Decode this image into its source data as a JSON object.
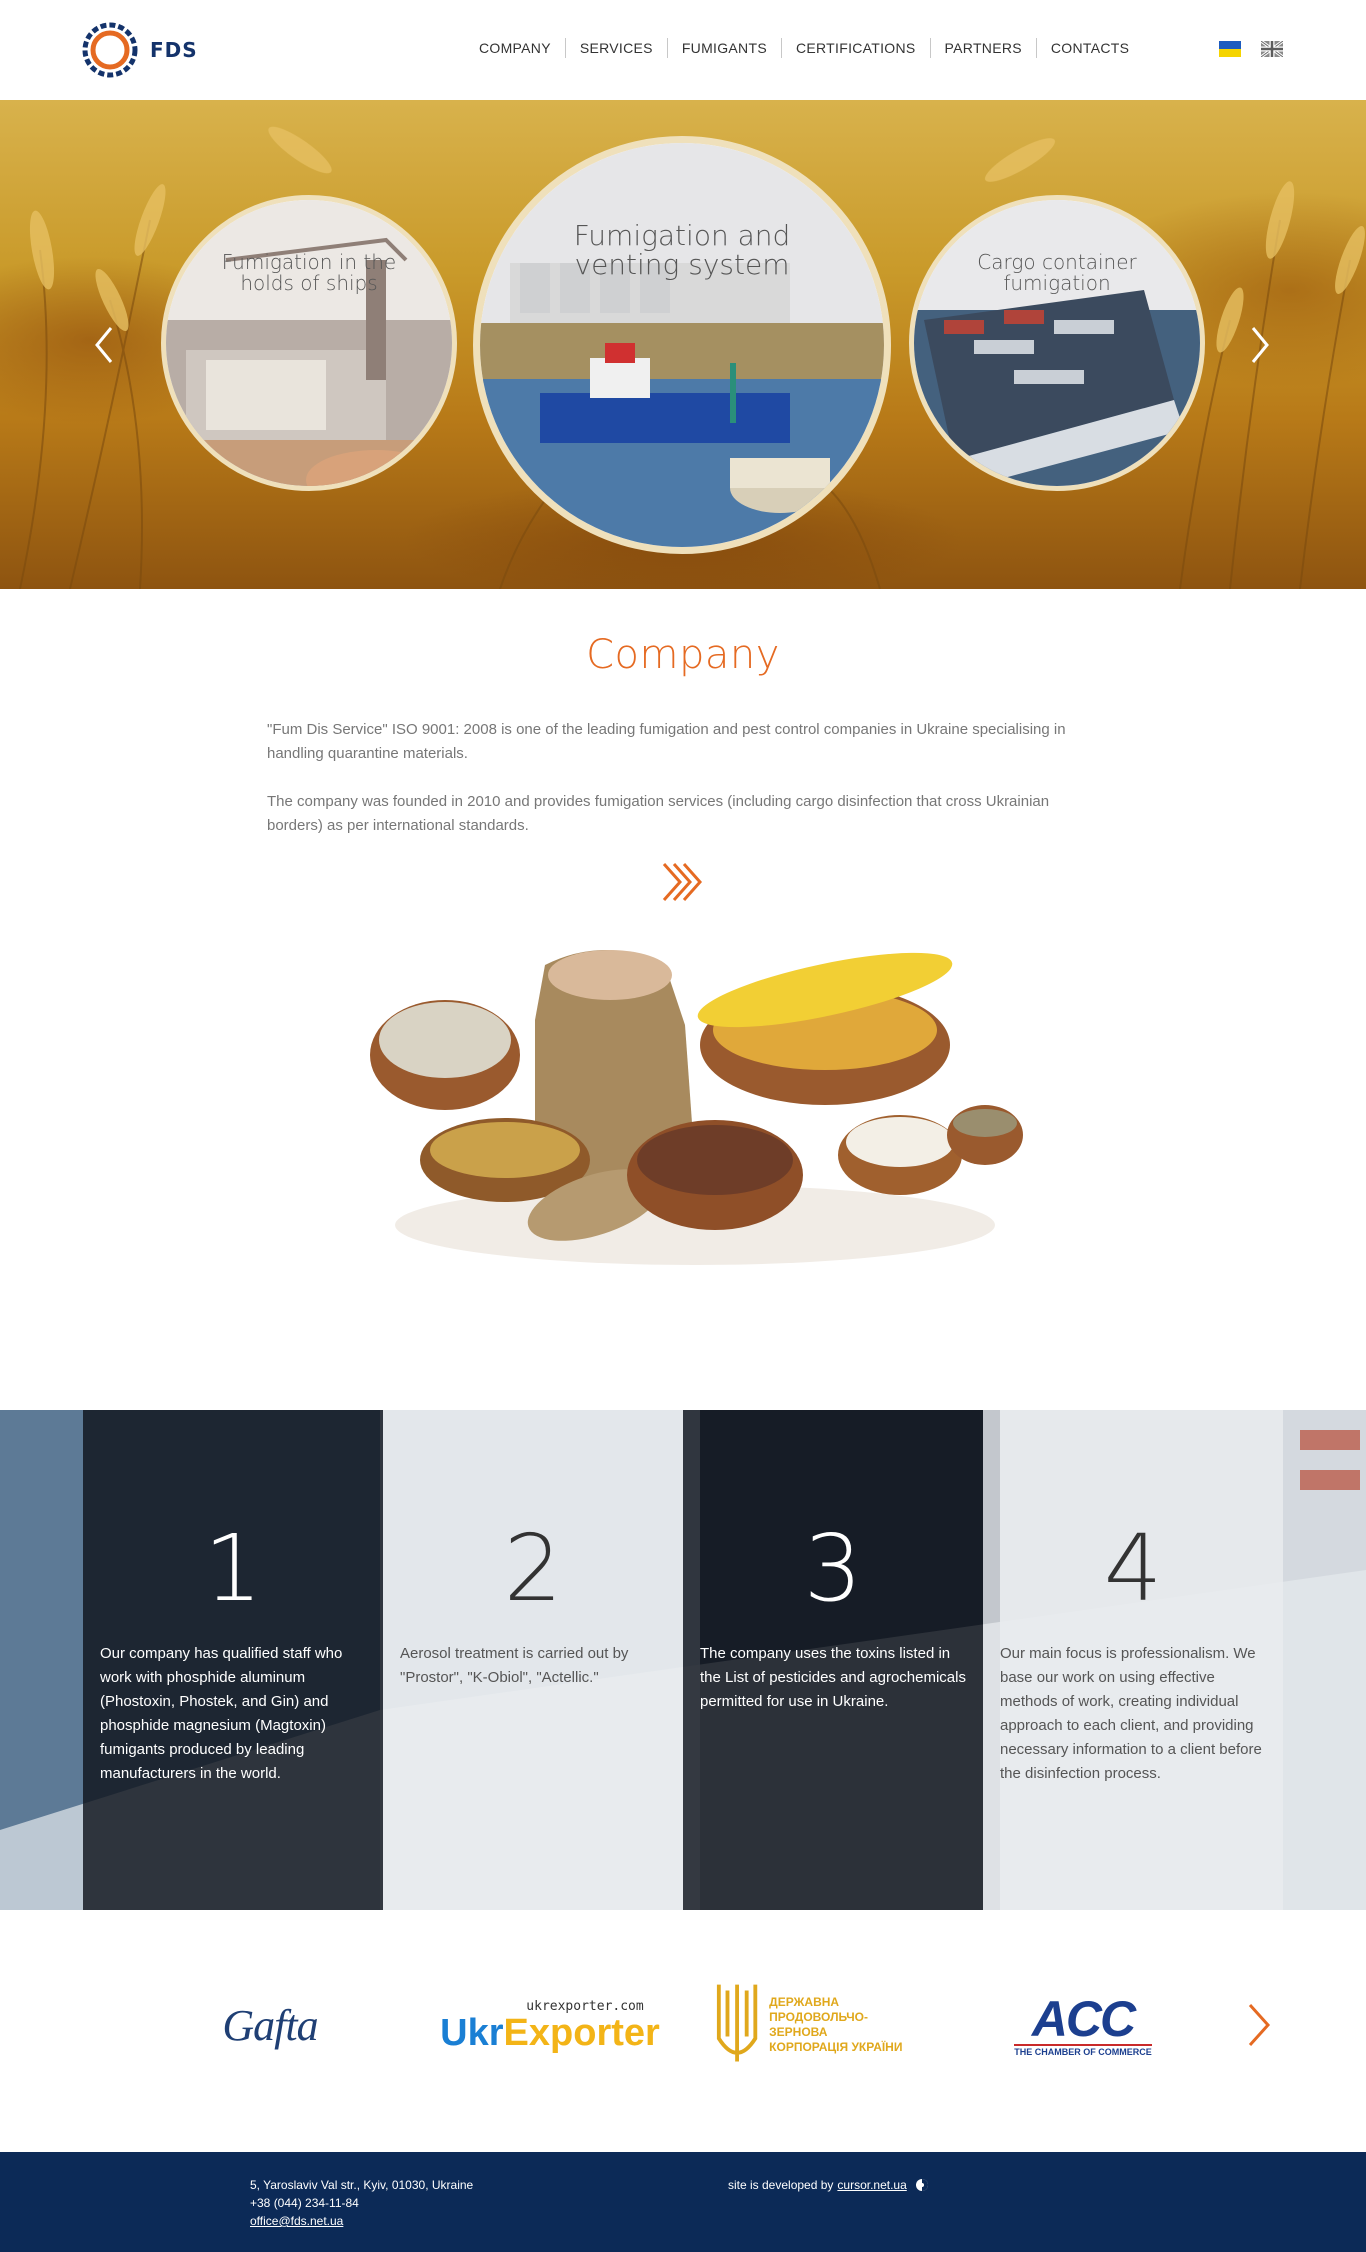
{
  "header": {
    "logo_text": "FDS",
    "nav": [
      "COMPANY",
      "SERVICES",
      "FUMIGANTS",
      "CERTIFICATIONS",
      "PARTNERS",
      "CONTACTS"
    ],
    "languages": [
      "ua-flag",
      "uk-flag"
    ]
  },
  "slider": {
    "slides": [
      {
        "title_line1": "Fumigation in the",
        "title_line2": "holds of ships"
      },
      {
        "title_line1": "Fumigation and",
        "title_line2": "venting system"
      },
      {
        "title_line1": "Cargo container",
        "title_line2": "fumigation"
      }
    ],
    "prev_icon": "chevron-left-icon",
    "next_icon": "chevron-right-icon"
  },
  "company": {
    "title": "Company",
    "paragraph1": "\"Fum Dis Service\" ISO 9001: 2008 is one of the leading fumigation and pest control companies in Ukraine specialising in handling quarantine materials.",
    "paragraph2": "The company was founded in 2010 and provides fumigation services (including cargo disinfection that cross Ukrainian borders) as per international standards.",
    "more_icon": "double-chevron-right-icon"
  },
  "features": [
    {
      "number": "1",
      "text": "Our company has qualified staff who work with phosphide aluminum (Phostoxin, Phostek, and Gin) and phosphide magnesium (Magtoxin) fumigants produced by leading manufacturers in the world."
    },
    {
      "number": "2",
      "text": "Aerosol treatment is carried out by \"Prostor\", \"K-Obiol\", \"Actellic.\""
    },
    {
      "number": "3",
      "text": "The company uses the toxins listed in the List of pesticides and agrochemicals permitted for use in Ukraine."
    },
    {
      "number": "4",
      "text": "Our main focus is professionalism. We base our work on using effective methods of work, creating individual approach to each client, and providing necessary information to a client before the disinfection process."
    }
  ],
  "partners": {
    "gafta": "Gafta",
    "ukrexporter_top": "ukrexporter.com",
    "ukrexporter_ukr": "Ukr",
    "ukrexporter_exp": "Exporter",
    "dpzku_line1": "ДЕРЖАВНА",
    "dpzku_line2": "ПРОДОВОЛЬЧО-ЗЕРНОВА",
    "dpzku_line3": "КОРПОРАЦІЯ УКРАЇНИ",
    "acc_logo": "ACC",
    "acc_sub": "THE CHAMBER OF COMMERCE",
    "next_icon": "chevron-right-icon"
  },
  "footer": {
    "address": "5, Yaroslaviv Val str., Kyiv, 01030, Ukraine",
    "phone": "+38 (044) 234-11-84",
    "email": "office@fds.net.ua",
    "dev_prefix": "site is developed by",
    "dev_link": "cursor.net.ua"
  },
  "colors": {
    "accent": "#e56a22",
    "footer_bg": "#0c2a57",
    "logo_blue": "#14336b"
  }
}
